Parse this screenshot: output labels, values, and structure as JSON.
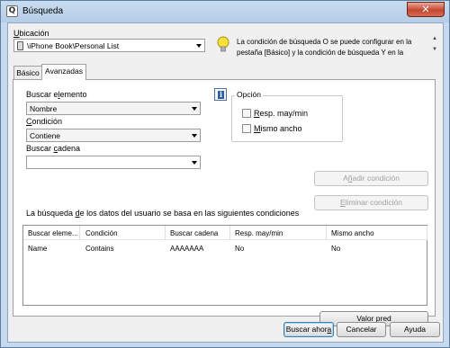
{
  "window": {
    "title": "Búsqueda",
    "close_glyph": "✕",
    "app_icon": "Q"
  },
  "location": {
    "label_underlined": "U",
    "label_rest": "bicación",
    "value": "\\iPhone Book\\Personal List",
    "icon": "phone-book-icon"
  },
  "info": {
    "icon": "lightbulb-icon",
    "text": "La condición de búsqueda O se puede configurar en la pestaña [Básico] y la condición de búsqueda Y en la"
  },
  "tabs": [
    {
      "label": "Básico",
      "active": false
    },
    {
      "label": "Avanzadas",
      "active": true
    }
  ],
  "search_element": {
    "label_pre": "Buscar e",
    "label_underlined": "l",
    "label_post": "emento",
    "value": "Nombre"
  },
  "condition": {
    "label_underlined": "C",
    "label_rest": "ondición",
    "value": "Contiene"
  },
  "search_string": {
    "label_pre": "Buscar ",
    "label_underlined": "c",
    "label_post": "adena",
    "value": ""
  },
  "option_group": {
    "title": "Opción",
    "info_glyph": "i",
    "case_sensitive": {
      "label_underlined": "R",
      "label_rest": "esp. may/min",
      "checked": false
    },
    "same_width": {
      "label_underlined": "M",
      "label_rest": "ismo ancho",
      "checked": false
    }
  },
  "buttons": {
    "add_condition": {
      "pre": "A",
      "underlined": "ñ",
      "post": "adir condición"
    },
    "remove_condition": {
      "pre": "",
      "underlined": "E",
      "post": "liminar condición"
    },
    "default_value": {
      "pre": "Valor ",
      "underlined": "p",
      "post": "red"
    },
    "search_now": {
      "pre": "Buscar ahor",
      "underlined": "a",
      "post": ""
    },
    "cancel": "Cancelar",
    "help": "Ayuda"
  },
  "conditions_caption": {
    "pre": "La búsqueda ",
    "underlined": "d",
    "post": "e los datos del usuario se basa en las siguientes condiciones"
  },
  "table": {
    "columns": [
      "Buscar eleme...",
      "Condición",
      "Buscar cadena",
      "Resp. may/min",
      "Mismo ancho"
    ],
    "rows": [
      [
        "Name",
        "Contains",
        "AAAAAAA",
        "No",
        "No"
      ]
    ]
  }
}
